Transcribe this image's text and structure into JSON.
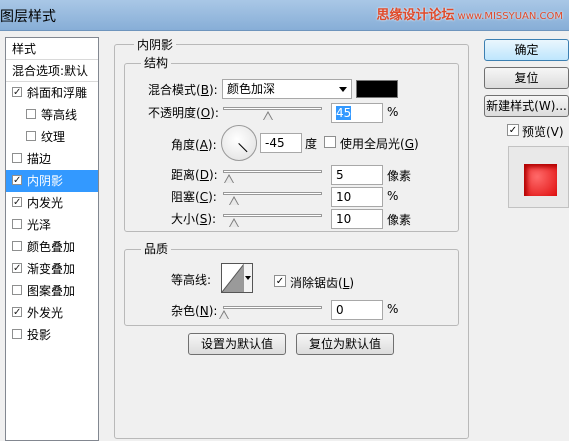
{
  "window": {
    "title": "图层样式",
    "watermark": "思缘设计论坛",
    "watermark_url": "www.MISSYUAN.COM"
  },
  "styles_panel": {
    "header": "样式",
    "blend_options": "混合选项:默认",
    "items": [
      {
        "label": "斜面和浮雕",
        "checked": true
      },
      {
        "label": "等高线",
        "checked": false,
        "indent": true
      },
      {
        "label": "纹理",
        "checked": false,
        "indent": true
      },
      {
        "label": "描边",
        "checked": false
      },
      {
        "label": "内阴影",
        "checked": true,
        "selected": true
      },
      {
        "label": "内发光",
        "checked": true
      },
      {
        "label": "光泽",
        "checked": false
      },
      {
        "label": "颜色叠加",
        "checked": false
      },
      {
        "label": "渐变叠加",
        "checked": true
      },
      {
        "label": "图案叠加",
        "checked": false
      },
      {
        "label": "外发光",
        "checked": true
      },
      {
        "label": "投影",
        "checked": false
      }
    ]
  },
  "inner_shadow": {
    "group_title": "内阴影",
    "structure": {
      "title": "结构",
      "blend_mode": {
        "label": "混合模式",
        "key": "B",
        "value": "颜色加深",
        "color": "#000000"
      },
      "opacity": {
        "label": "不透明度",
        "key": "O",
        "value": "45",
        "unit": "%"
      },
      "angle": {
        "label": "角度",
        "key": "A",
        "value": "-45",
        "unit": "度"
      },
      "global_light": {
        "label": "使用全局光",
        "key": "G",
        "checked": false
      },
      "distance": {
        "label": "距离",
        "key": "D",
        "value": "5",
        "unit": "像素"
      },
      "choke": {
        "label": "阻塞",
        "key": "C",
        "value": "10",
        "unit": "%"
      },
      "size": {
        "label": "大小",
        "key": "S",
        "value": "10",
        "unit": "像素"
      }
    },
    "quality": {
      "title": "品质",
      "contour": {
        "label": "等高线"
      },
      "anti_alias": {
        "label": "消除锯齿",
        "key": "L",
        "checked": true
      },
      "noise": {
        "label": "杂色",
        "key": "N",
        "value": "0",
        "unit": "%"
      }
    },
    "buttons": {
      "make_default": "设置为默认值",
      "reset_default": "复位为默认值"
    }
  },
  "actions": {
    "ok": "确定",
    "reset": "复位",
    "new_style": "新建样式(W)...",
    "preview": {
      "label": "预览(V)",
      "checked": true
    }
  }
}
